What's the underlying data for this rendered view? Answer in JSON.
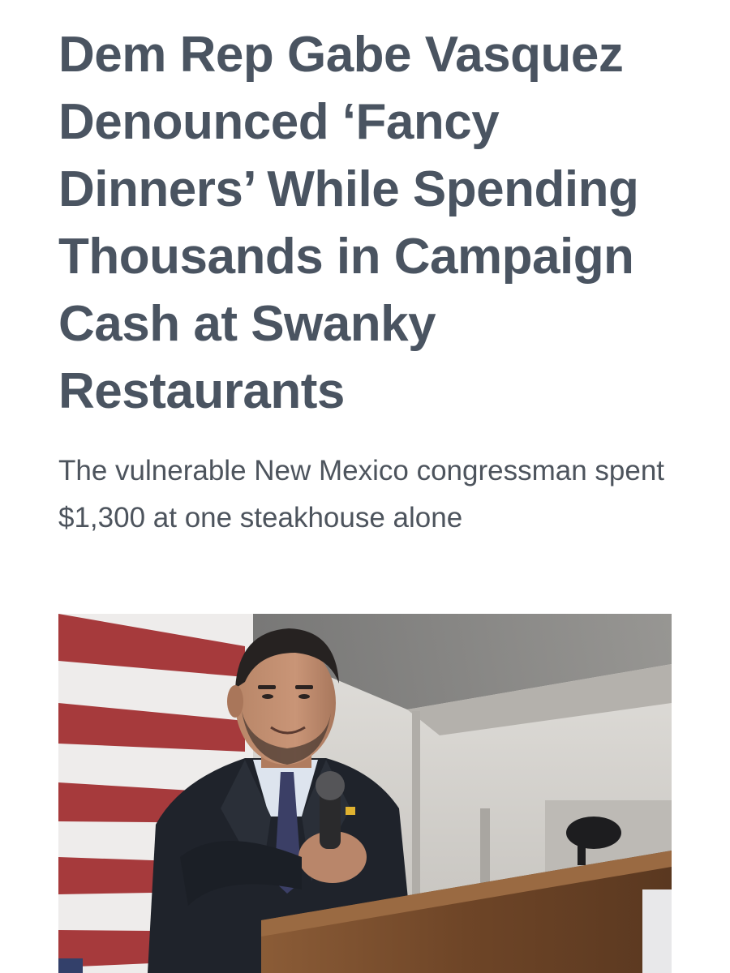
{
  "article": {
    "headline": "Dem Rep Gabe Vasquez Denounced ‘Fancy Dinners’ While Spending Thousands in Campaign Cash at Swanky Restaurants",
    "dek": "The vulnerable New Mexico congressman spent $1,300 at one steakhouse alone"
  },
  "hero_image": {
    "subject": "man-speaking-at-podium-photo",
    "colors": {
      "flag_red": "#a63a3c",
      "flag_white": "#eeeceb",
      "wall": "#d4d1cc",
      "suit": "#1f232b",
      "podium": "#7a4f2f"
    }
  }
}
